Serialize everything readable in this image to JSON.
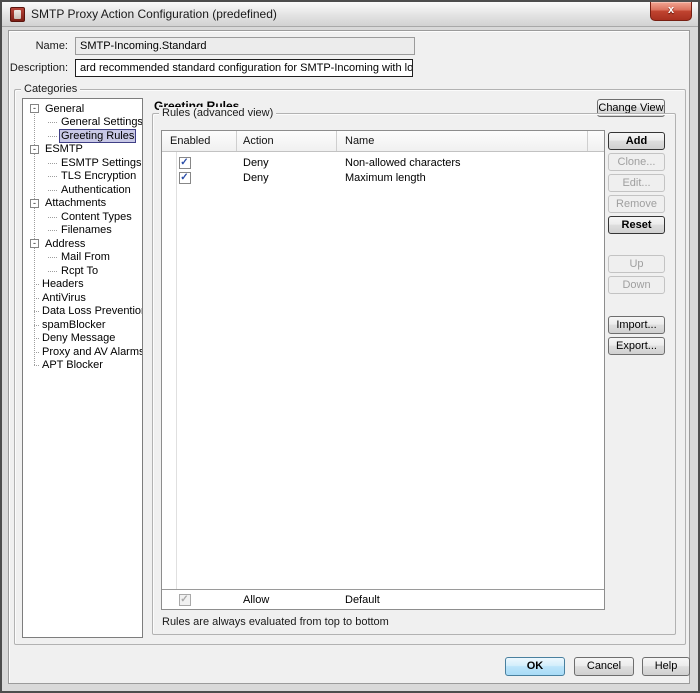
{
  "window": {
    "title": "SMTP Proxy Action Configuration (predefined)"
  },
  "icons": {
    "close": "x",
    "collapse": "-",
    "check": "✓"
  },
  "form": {
    "name_label": "Name:",
    "name_value": "SMTP-Incoming.Standard",
    "description_label": "Description:",
    "description_value": "ard recommended standard configuration for SMTP-Incoming with logging enabled"
  },
  "categories": {
    "group_label": "Categories",
    "items": [
      {
        "label": "General",
        "type": "parent"
      },
      {
        "label": "General Settings",
        "type": "child"
      },
      {
        "label": "Greeting Rules",
        "type": "child",
        "selected": true
      },
      {
        "label": "ESMTP",
        "type": "parent"
      },
      {
        "label": "ESMTP Settings",
        "type": "child"
      },
      {
        "label": "TLS Encryption",
        "type": "child"
      },
      {
        "label": "Authentication",
        "type": "child"
      },
      {
        "label": "Attachments",
        "type": "parent"
      },
      {
        "label": "Content Types",
        "type": "child"
      },
      {
        "label": "Filenames",
        "type": "child"
      },
      {
        "label": "Address",
        "type": "parent"
      },
      {
        "label": "Mail From",
        "type": "child"
      },
      {
        "label": "Rcpt To",
        "type": "child"
      },
      {
        "label": "Headers",
        "type": "leaf-root"
      },
      {
        "label": "AntiVirus",
        "type": "leaf-root"
      },
      {
        "label": "Data Loss Prevention",
        "type": "leaf-root"
      },
      {
        "label": "spamBlocker",
        "type": "leaf-root"
      },
      {
        "label": "Deny Message",
        "type": "leaf-root"
      },
      {
        "label": "Proxy and AV Alarms",
        "type": "leaf-root"
      },
      {
        "label": "APT Blocker",
        "type": "leaf-root"
      }
    ]
  },
  "panel": {
    "heading": "Greeting Rules",
    "change_view": "Change View",
    "rules_group_label": "Rules (advanced view)",
    "footnote": "Rules are always evaluated from top to bottom"
  },
  "rules_table": {
    "columns": [
      "Enabled",
      "Action",
      "Name"
    ],
    "rows": [
      {
        "enabled": true,
        "action": "Deny",
        "name": "Non-allowed characters"
      },
      {
        "enabled": true,
        "action": "Deny",
        "name": "Maximum length"
      }
    ],
    "default_row": {
      "enabled": true,
      "action": "Allow",
      "name": "Default"
    }
  },
  "side_buttons": {
    "add": "Add",
    "clone": "Clone...",
    "edit": "Edit...",
    "remove": "Remove",
    "reset": "Reset",
    "up": "Up",
    "down": "Down",
    "import": "Import...",
    "export": "Export..."
  },
  "footer_buttons": {
    "ok": "OK",
    "cancel": "Cancel",
    "help": "Help"
  }
}
